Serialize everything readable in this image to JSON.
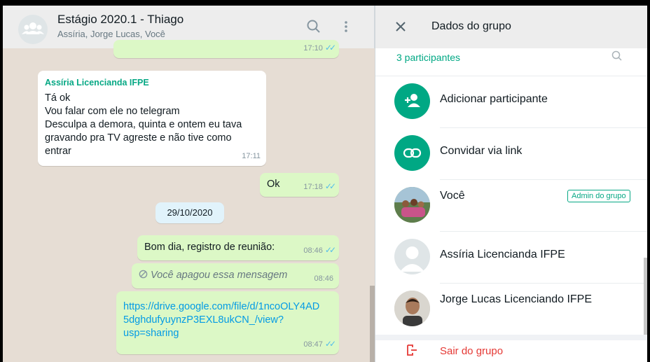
{
  "chat": {
    "title": "Estágio 2020.1 - Thiago",
    "subtitle": "Assíria, Jorge Lucas, Você",
    "messages": [
      {
        "time": "17:10"
      },
      {
        "sender": "Assíria Licencianda IFPE",
        "lines": [
          "Tá ok",
          "Vou falar com ele no telegram",
          "Desculpa a demora, quinta e ontem eu tava",
          "gravando pra TV agreste e não tive como",
          "entrar"
        ],
        "time": "17:11"
      },
      {
        "text": "Ok",
        "time": "17:18"
      },
      {
        "date": "29/10/2020"
      },
      {
        "text": "Bom dia, registro de reunião:",
        "time": "08:46"
      },
      {
        "text": "Você apagou essa mensagem",
        "time": "08:46"
      },
      {
        "link_lines": [
          "https://drive.google.com/file/d/1ncoOLY4AD",
          "5dghdufyuynzP3EXL8ukCN_/view?",
          "usp=sharing"
        ],
        "time": "08:47"
      }
    ]
  },
  "panel": {
    "title": "Dados do grupo",
    "participants_count": "3 participantes",
    "rows": [
      {
        "label": "Adicionar participante"
      },
      {
        "label": "Convidar via link"
      },
      {
        "label": "Você",
        "badge": "Admin do grupo"
      },
      {
        "label": "Assíria Licencianda IFPE"
      },
      {
        "label": "Jorge Lucas Licenciando IFPE"
      }
    ],
    "exit_label": "Sair do grupo"
  },
  "colors": {
    "accent": "#00a884",
    "out_bubble": "#dcf8c6",
    "danger": "#e53935"
  }
}
